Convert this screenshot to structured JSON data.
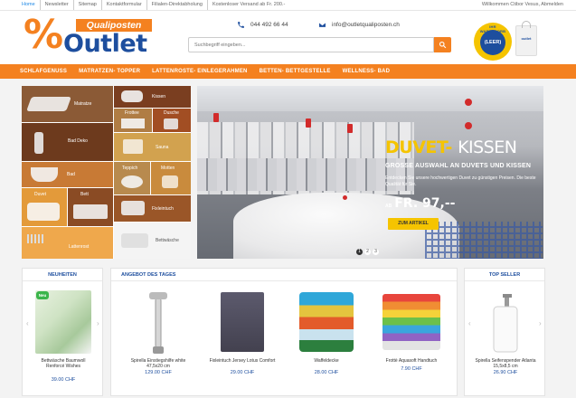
{
  "topbar": {
    "links": [
      "Home",
      "Newsletter",
      "Sitemap",
      "Kontaktformular",
      "Filialen-Direktabholung",
      "Kostenloser Versand ab Fr. 200.-"
    ],
    "welcome": "Willkommen Ctibor Vesus,  Abmelden"
  },
  "header": {
    "logo_pct": "%",
    "logo_tag": "Qualiposten",
    "logo_word": "Outlet",
    "phone": "044 492 66 44",
    "email": "info@outletqualiposten.ch",
    "search_placeholder": "Suchbegriff eingeben...",
    "cart_label": "IHR WARENKORB",
    "cart_status": "(LEER)",
    "bag_label": "outlet"
  },
  "nav": [
    "SCHLAFGENUSS",
    "MATRATZEN- TOPPER",
    "LATTENROSTE- EINLEGERAHMEN",
    "BETTEN- BETTGESTELLE",
    "WELLNESS- BAD"
  ],
  "categories": {
    "matratze": "Matratze",
    "kissen": "Kissen",
    "frottee": "Frottee",
    "dusche": "Dusche",
    "bad_deko": "Bad Deko",
    "sauna": "Sauna",
    "bad": "Bad",
    "teppich": "Teppich",
    "motten": "Motten",
    "duvet": "Duvet",
    "bett": "Bett",
    "fixleintuch": "Fixleintuch",
    "lattenrost": "Lattenrost",
    "bettwaesche": "Bettwäsche"
  },
  "hero": {
    "title_highlight": "DUVET-",
    "title_rest": "KISSEN",
    "subtitle": "GROSSE AUSWAHL AN DUVETS UND KISSEN",
    "text": "Entdecken Sie unsere hochwertigen Duvet zu günstigen Preisen. Die beste Qualität für Sie.",
    "price_prefix": "AB",
    "price": "FR. 97,--",
    "cta": "ZUM ARTIKEL",
    "dots": [
      "1",
      "2",
      "3"
    ],
    "active_dot": 1
  },
  "neuheiten": {
    "title": "NEUHEITEN",
    "badge": "Neu",
    "product": {
      "name": "Bettwäsche Baumwoll Renforcé Wishes",
      "price": "39.00 CHF"
    }
  },
  "angebot": {
    "title": "ANGEBOT DES TAGES",
    "products": [
      {
        "name": "Spirella Einstiegshilfe white 47,5x20 cm",
        "price": "129.00 CHF"
      },
      {
        "name": "Fixleintuch Jersey Lotus Comfort",
        "price": "29.00 CHF"
      },
      {
        "name": "Waffeldecke",
        "price": "28.00 CHF"
      },
      {
        "name": "Frottè Aquasoft Handtuch",
        "price": "7.90 CHF"
      }
    ]
  },
  "topseller": {
    "title": "TOP SELLER",
    "product": {
      "name": "Spirella Seifenspender Atlanta 15,5x8,5 cm",
      "price": "26.90 CHF"
    }
  },
  "colors": {
    "accent": "#f48120",
    "brand": "#1d4e9e",
    "highlight": "#f5c400"
  }
}
